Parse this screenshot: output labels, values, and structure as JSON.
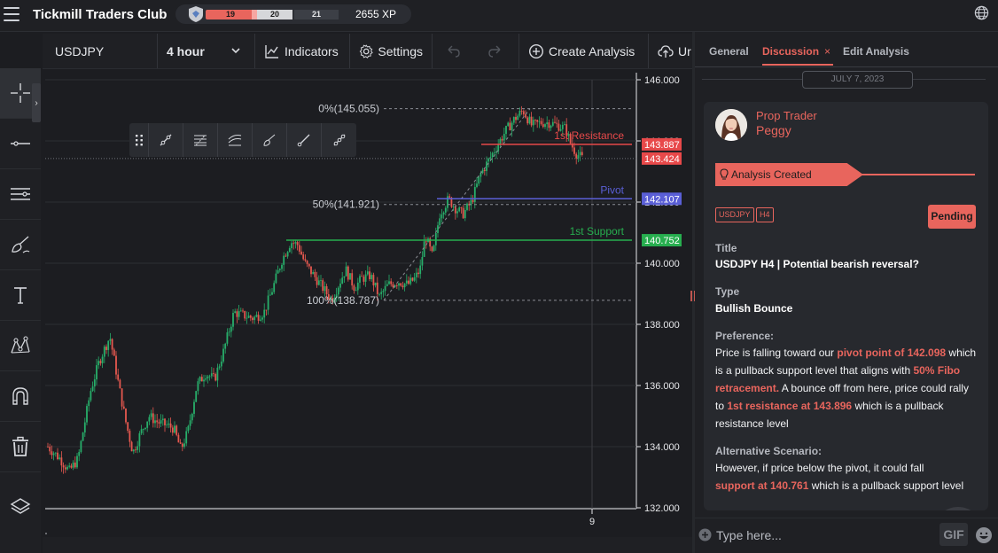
{
  "app": {
    "title": "Tickmill Traders Club",
    "xp": {
      "seg1": "19",
      "seg2": "20",
      "seg3": "21",
      "total": "2655 XP"
    }
  },
  "icons": {
    "menu": "hamburger-icon",
    "globe": "globe-icon",
    "badge": "badge-icon"
  },
  "chart_toolbar": {
    "symbol": "USDJPY",
    "timeframe": "4 hour",
    "indicators": "Indicators",
    "settings": "Settings",
    "create": "Create Analysis",
    "upload": "Ur"
  },
  "left_tools": [
    "crosshair",
    "horizontal-line",
    "parallel-lines",
    "brush",
    "text",
    "pattern",
    "magnet",
    "trash",
    "layers"
  ],
  "chart_data": {
    "type": "candlestick",
    "symbol": "USDJPY",
    "ylim": [
      132.0,
      146.0
    ],
    "y_ticks": [
      "146.000",
      "144.000",
      "142.000",
      "140.000",
      "138.000",
      "136.000",
      "134.000",
      "132.000"
    ],
    "x_ticks": [
      "9"
    ],
    "levels": [
      {
        "name": "1st Resistance",
        "value": 143.887,
        "label": "143.887",
        "color": "#e8494a",
        "line_label": "1st Resistance"
      },
      {
        "name": "Pivot",
        "value": 142.107,
        "label": "142.107",
        "color": "#5a5fd6",
        "line_label": "Pivot"
      },
      {
        "name": "1st Support",
        "value": 140.752,
        "label": "140.752",
        "color": "#27ae4f",
        "line_label": "1st Support"
      }
    ],
    "last_price": {
      "value": 143.424,
      "label": "143.424",
      "color": "#e8494a"
    },
    "fibonacci": [
      {
        "label": "0%(145.055)",
        "value": 145.055
      },
      {
        "label": "50%(141.921)",
        "value": 141.921
      },
      {
        "label": "100%(138.787)",
        "value": 138.787
      }
    ],
    "grid": true
  },
  "panel": {
    "tabs": {
      "general": "General",
      "discussion": "Discussion",
      "close": "×",
      "edit": "Edit Analysis"
    },
    "date": "JULY 7, 2023",
    "author": {
      "role": "Prop Trader",
      "name": "Peggy"
    },
    "status_banner": "Analysis Created",
    "tags": [
      "USDJPY",
      "H4"
    ],
    "status": "Pending",
    "title_label": "Title",
    "title": "USDJPY H4 | Potential bearish reversal?",
    "type_label": "Type",
    "type": "Bullish Bounce",
    "pref_label": "Preference:",
    "pref": {
      "p1": "Price is falling toward our ",
      "h1": "pivot point of 142.098",
      "p2": " which is a pullback support level that aligns with ",
      "h2": "50% Fibo retracement.",
      "p3": " A bounce off from here, price could rally to ",
      "h3": "1st resistance at 143.896",
      "p4": " which is a pullback resistance level"
    },
    "alt_label": "Alternative Scenario:",
    "alt": {
      "p1": "However, if price below the pivot, it could fall",
      "h1": "support at 140.761",
      "p2": " which is a pullback support level"
    },
    "composer": {
      "placeholder": "Type here...",
      "gif": "GIF"
    }
  }
}
